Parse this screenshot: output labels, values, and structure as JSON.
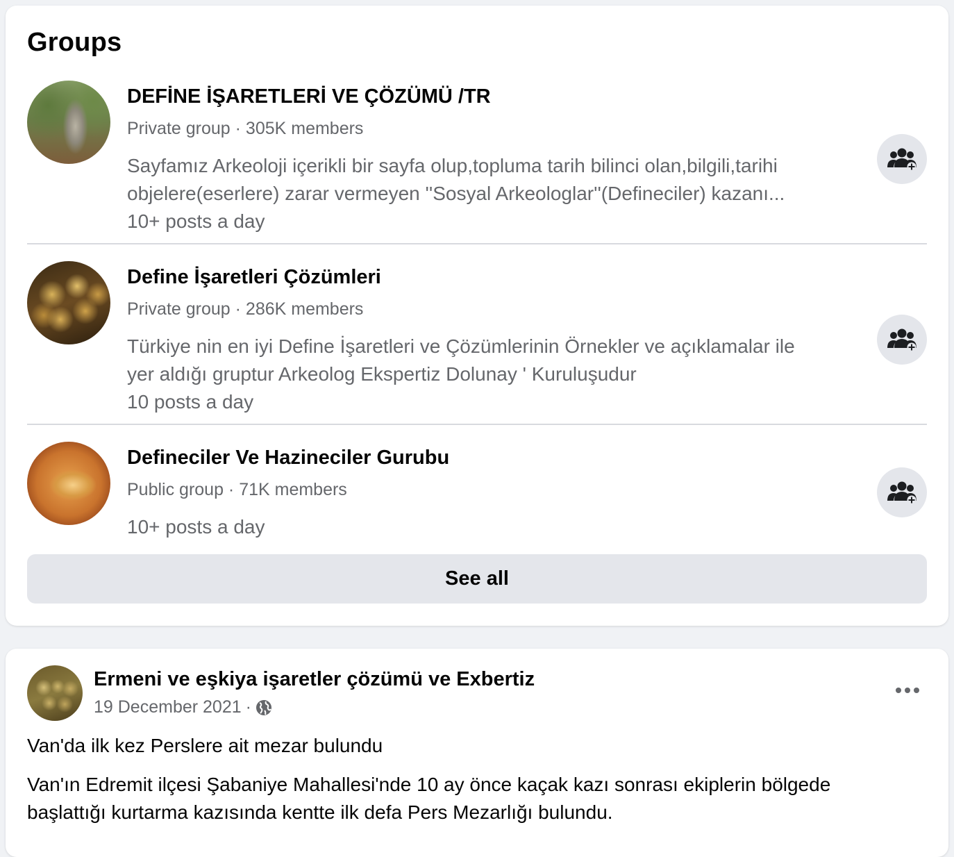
{
  "groups_section": {
    "title": "Groups",
    "see_all_label": "See all",
    "items": [
      {
        "name": "DEFİNE İŞARETLERİ VE ÇÖZÜMÜ /TR",
        "meta": "Private group · 305K members",
        "description_lines": [
          "Sayfamız Arkeoloji içerikli bir sayfa olup,topluma tarih bilinci olan,bilgili,tarihi",
          "objelere(eserlere) zarar vermeyen ''Sosyal Arkeologlar''(Defineciler) kazanı..."
        ],
        "activity": "10+ posts a day",
        "join_icon": "join-group-icon"
      },
      {
        "name": "Define İşaretleri Çözümleri",
        "meta": "Private group · 286K members",
        "description_lines": [
          "Türkiye nin en iyi Define İşaretleri ve Çözümlerinin Örnekler ve açıklamalar ile",
          "yer aldığı gruptur Arkeolog Ekspertiz Dolunay ' Kuruluşudur"
        ],
        "activity": "10 posts a day",
        "join_icon": "join-group-icon"
      },
      {
        "name": "Defineciler Ve Hazineciler Gurubu",
        "meta": "Public group · 71K members",
        "description_lines": [],
        "activity": "10+ posts a day",
        "join_icon": "join-group-icon"
      }
    ]
  },
  "post": {
    "author": "Ermeni ve eşkiya işaretler çözümü ve Exbertiz",
    "date": "19 December 2021",
    "separator": "·",
    "audience_icon": "globe-icon",
    "more_icon": "more-options-icon",
    "headline": "Van'da ilk kez Perslere ait mezar bulundu",
    "body_lines": [
      "Van'ın Edremit ilçesi Şabaniye Mahallesi'nde 10 ay önce kaçak kazı sonrası ekiplerin bölgede",
      "başlattığı kurtarma kazısında kentte ilk defa Pers Mezarlığı bulundu."
    ]
  },
  "colors": {
    "page_background": "#f0f2f5",
    "card_background": "#ffffff",
    "secondary_text": "#65676b",
    "button_background": "#e4e6eb",
    "primary_text": "#050505"
  }
}
